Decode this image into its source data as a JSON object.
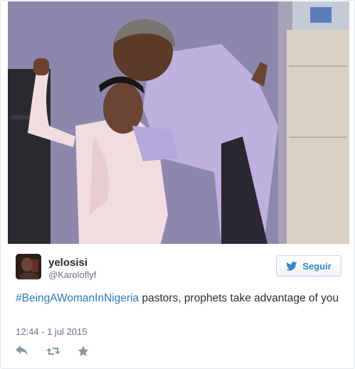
{
  "tweet": {
    "display_name": "yelosisi",
    "handle": "@Karoloflyf",
    "hashtag": "#BeingAWomanInNigeria",
    "text_rest": " pastors, prophets take advantage of you",
    "timestamp": "12:44 - 1 jul 2015"
  },
  "follow_button": {
    "label": "Seguir",
    "icon": "twitter-bird-icon"
  },
  "actions": [
    {
      "name": "reply",
      "icon": "reply-icon"
    },
    {
      "name": "retweet",
      "icon": "retweet-icon"
    },
    {
      "name": "favorite",
      "icon": "star-icon"
    }
  ],
  "colors": {
    "link": "#2b7bb9",
    "follow_label": "#3d85c6",
    "muted": "#66757f",
    "text": "#292f33",
    "action_icon": "#8899a6"
  }
}
